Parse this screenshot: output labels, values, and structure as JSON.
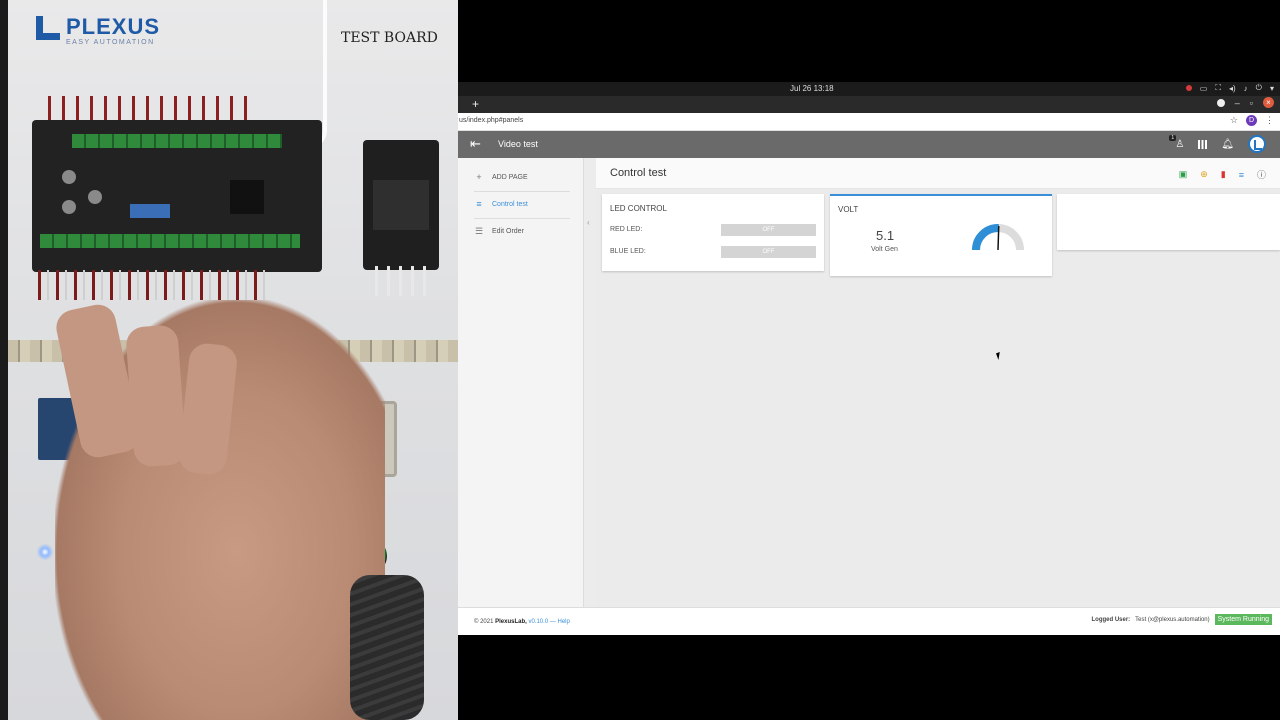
{
  "camera": {
    "logo_name": "PLEXUS",
    "logo_tagline": "EASY AUTOMATION",
    "board_label": "TEST BOARD"
  },
  "system": {
    "clock": "Jul 26  13:18"
  },
  "browser": {
    "url": "us/index.php#panels",
    "profile_initial": "D",
    "new_tab": "+",
    "close": "×"
  },
  "app": {
    "back_glyph": "⇤",
    "title": "Video test",
    "notification_count": "1",
    "user_initial": "L"
  },
  "sidebar": {
    "items": [
      {
        "icon": "+",
        "label": "ADD PAGE"
      },
      {
        "icon": "≡",
        "label": "Control test"
      },
      {
        "icon": "☰",
        "label": "Edit Order"
      }
    ],
    "collapse_glyph": "‹"
  },
  "panel": {
    "title": "Control test"
  },
  "cards": {
    "led": {
      "title": "LED CONTROL",
      "rows": [
        {
          "label": "RED LED:",
          "state": "OFF"
        },
        {
          "label": "BLUE LED:",
          "state": "OFF"
        }
      ]
    },
    "volt": {
      "title": "VOLT",
      "value": "5.1",
      "label": "Volt Gen",
      "gauge_fraction": 0.51,
      "accent": "#2f8fd6"
    }
  },
  "footer": {
    "copyright": "© 2021",
    "brand": "PlexusLab,",
    "version": "v0.10.0 — Help",
    "logged_label": "Logged User:",
    "logged_user": "Test (x@plexus.automation)",
    "status": "System Running"
  }
}
